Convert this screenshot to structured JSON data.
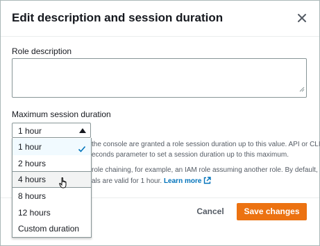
{
  "modal": {
    "title": "Edit description and session duration",
    "close_icon": "close-icon"
  },
  "role_description": {
    "label": "Role description",
    "value": ""
  },
  "session_duration": {
    "label": "Maximum session duration",
    "selected": "1 hour",
    "hint_line1": "the console are granted a role session duration up to this value. API or CLI",
    "hint_line2": "econds parameter to set a session duration up to this maximum.",
    "hint_line3": "role chaining, for example, an IAM role assuming another role. By default,",
    "hint_line4": "als are valid for 1 hour.",
    "learn_more": "Learn more",
    "options": [
      "1 hour",
      "2 hours",
      "4 hours",
      "8 hours",
      "12 hours",
      "Custom duration"
    ]
  },
  "footer": {
    "cancel_label": "Cancel",
    "save_label": "Save changes"
  },
  "colors": {
    "primary": "#ec7211",
    "link": "#0073bb",
    "check": "#0073bb"
  }
}
